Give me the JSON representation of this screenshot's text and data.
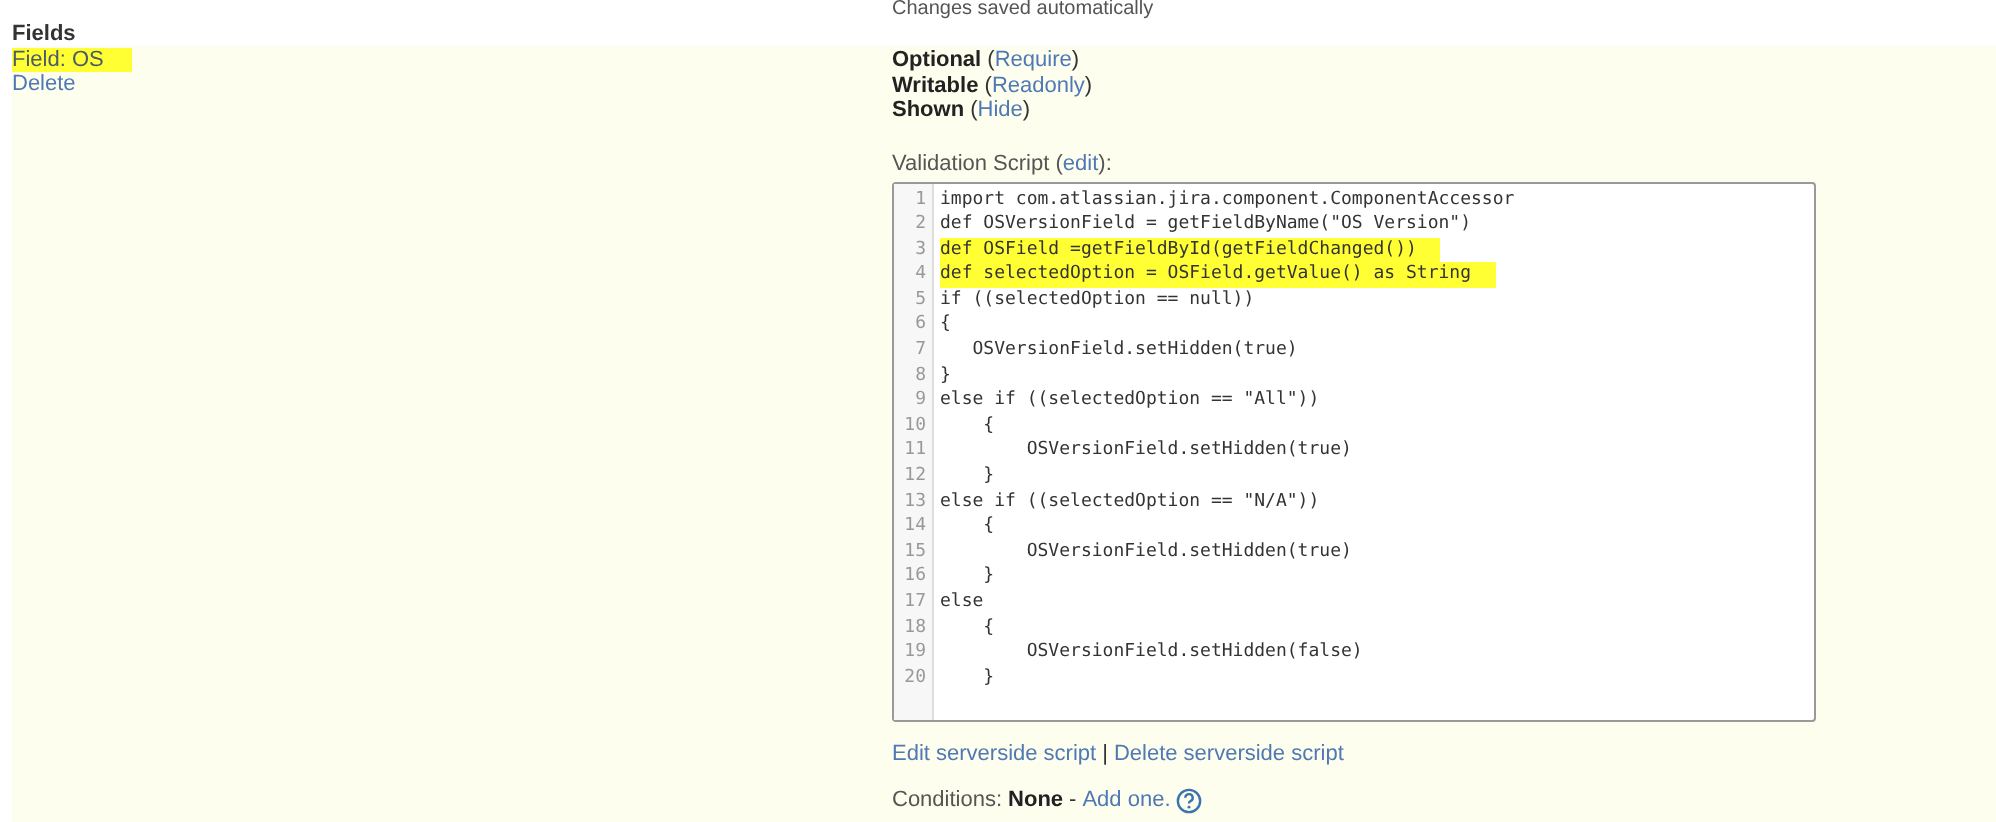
{
  "top_note": "Changes saved automatically",
  "fields_heading": "Fields",
  "field": {
    "label": "Field: OS",
    "highlighted": true,
    "delete": "Delete"
  },
  "properties": [
    {
      "state": "Optional",
      "open": "(",
      "action": "Require",
      "close": ")"
    },
    {
      "state": "Writable",
      "open": "(",
      "action": "Readonly",
      "close": ")"
    },
    {
      "state": "Shown",
      "open": "(",
      "action": "Hide",
      "close": ")"
    }
  ],
  "validation": {
    "label": "Validation Script",
    "open": "(",
    "edit": "edit",
    "suffix": "):"
  },
  "code_lines": [
    {
      "number": "1",
      "text": "import com.atlassian.jira.component.ComponentAccessor",
      "highlighted": false
    },
    {
      "number": "2",
      "text": "def OSVersionField = getFieldByName(\"OS Version\")",
      "highlighted": false
    },
    {
      "number": "3",
      "text": "def OSField =getFieldById(getFieldChanged())",
      "highlighted": true
    },
    {
      "number": "4",
      "text": "def selectedOption = OSField.getValue() as String",
      "highlighted": true
    },
    {
      "number": "5",
      "text": "if ((selectedOption == null))",
      "highlighted": false
    },
    {
      "number": "6",
      "text": "{",
      "highlighted": false
    },
    {
      "number": "7",
      "text": "   OSVersionField.setHidden(true)",
      "highlighted": false
    },
    {
      "number": "8",
      "text": "}",
      "highlighted": false
    },
    {
      "number": "9",
      "text": "else if ((selectedOption == \"All\"))",
      "highlighted": false
    },
    {
      "number": "10",
      "text": "    {",
      "highlighted": false
    },
    {
      "number": "11",
      "text": "        OSVersionField.setHidden(true)",
      "highlighted": false
    },
    {
      "number": "12",
      "text": "    }",
      "highlighted": false
    },
    {
      "number": "13",
      "text": "else if ((selectedOption == \"N/A\"))",
      "highlighted": false
    },
    {
      "number": "14",
      "text": "    {",
      "highlighted": false
    },
    {
      "number": "15",
      "text": "        OSVersionField.setHidden(true)",
      "highlighted": false
    },
    {
      "number": "16",
      "text": "    }",
      "highlighted": false
    },
    {
      "number": "17",
      "text": "else",
      "highlighted": false
    },
    {
      "number": "18",
      "text": "    {",
      "highlighted": false
    },
    {
      "number": "19",
      "text": "        OSVersionField.setHidden(false)",
      "highlighted": false
    },
    {
      "number": "20",
      "text": "    }",
      "highlighted": false
    }
  ],
  "serverside_links": [
    "Edit serverside script",
    "Delete serverside script"
  ],
  "serverside_separator": "|",
  "conditions": {
    "label": "Conditions:",
    "value": "None",
    "separator": "-",
    "link": "Add one."
  }
}
